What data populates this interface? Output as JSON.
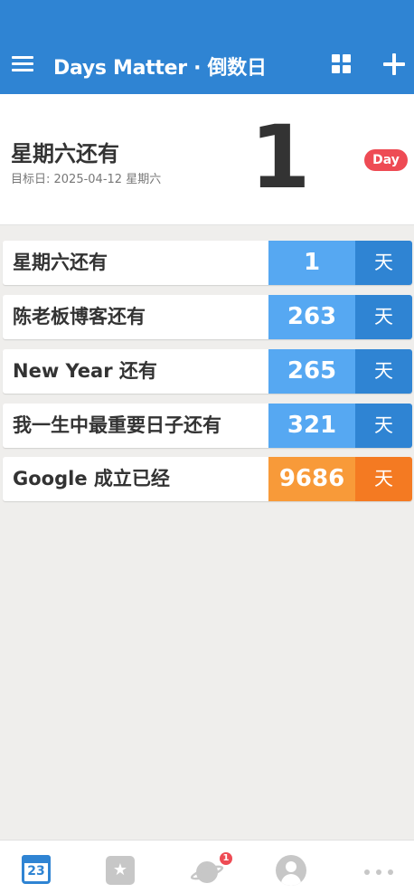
{
  "app": {
    "title": "Days Matter · 倒数日"
  },
  "hero": {
    "title": "星期六还有",
    "subtitle": "目标日: 2025-04-12 星期六",
    "count": "1",
    "badge": "Day"
  },
  "events": [
    {
      "title": "星期六还有",
      "days": "1",
      "unit": "天",
      "kind": "countdown"
    },
    {
      "title": "陈老板博客还有",
      "days": "263",
      "unit": "天",
      "kind": "countdown"
    },
    {
      "title": "New Year 还有",
      "days": "265",
      "unit": "天",
      "kind": "countdown"
    },
    {
      "title": "我一生中最重要日子还有",
      "days": "321",
      "unit": "天",
      "kind": "countdown"
    },
    {
      "title": "Google 成立已经",
      "days": "9686",
      "unit": "天",
      "kind": "elapsed"
    }
  ],
  "colors": {
    "countdown_num_bg": "#56a8f2",
    "countdown_unit_bg": "#2f84d3",
    "elapsed_num_bg": "#f89a39",
    "elapsed_unit_bg": "#f47a22",
    "topbar": "#2f84d3",
    "badge": "#ee4b54"
  },
  "tabbar": {
    "calendar_day": "23",
    "notification_count": "1",
    "icons": [
      "calendar-icon",
      "starred-list-icon",
      "planet-icon",
      "profile-icon",
      "more-icon"
    ]
  }
}
